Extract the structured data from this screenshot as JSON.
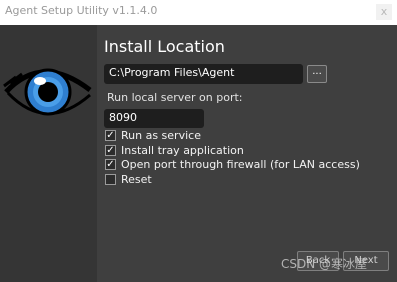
{
  "window": {
    "title": "Agent Setup Utility v1.1.4.0",
    "close_label": "x"
  },
  "icons": {
    "logo": "eye-icon",
    "close": "close-icon",
    "check": "checkmark-icon"
  },
  "colors": {
    "background": "#3f3f3f",
    "left_panel": "#353535",
    "field_bg": "#1e1e1e",
    "iris": "#2f7fd0"
  },
  "main": {
    "heading": "Install Location",
    "install_path": "C:\\Program Files\\Agent",
    "browse_label": "...",
    "port_label": "Run local server on port:",
    "port_value": "8090",
    "options": [
      {
        "label": "Run as service",
        "checked": true
      },
      {
        "label": "Install tray application",
        "checked": true
      },
      {
        "label": "Open port through firewall (for LAN access)",
        "checked": true
      },
      {
        "label": "Reset",
        "checked": false
      }
    ]
  },
  "footer": {
    "back_label": "Back",
    "next_label": "Next"
  },
  "watermark": "CSDN @寒冰屋"
}
